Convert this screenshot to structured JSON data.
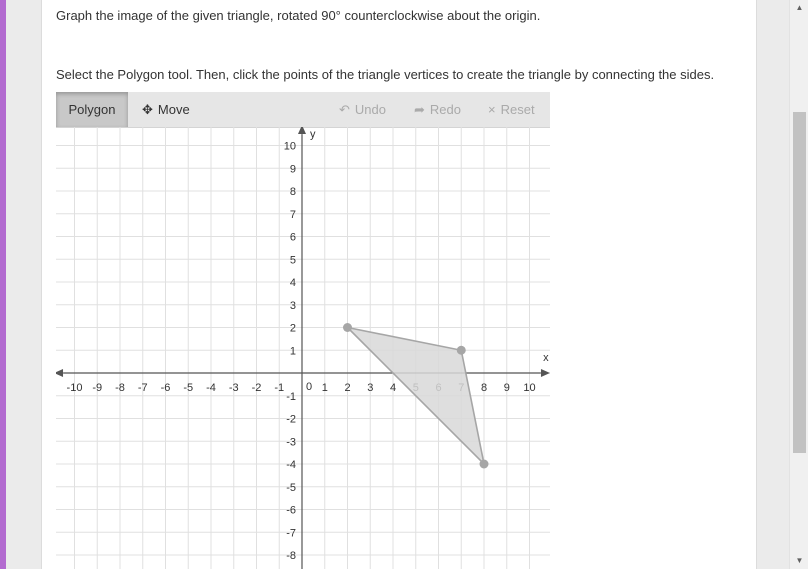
{
  "instructions": {
    "line1": "Graph the image of the given triangle, rotated 90° counterclockwise about the origin.",
    "line2": "Select the Polygon tool. Then, click the points of the triangle vertices to create the triangle by connecting the sides."
  },
  "toolbar": {
    "polygon_label": "Polygon",
    "move_label": "Move",
    "undo_label": "Undo",
    "redo_label": "Redo",
    "reset_label": "Reset",
    "move_icon": "✥",
    "undo_icon": "↶",
    "redo_icon": "➦",
    "reset_icon": "×"
  },
  "graph": {
    "x_axis_label": "x",
    "y_axis_label": "y",
    "x_range": [
      -10,
      10
    ],
    "y_range": [
      -10,
      10
    ],
    "origin_label": "0",
    "triangle_vertices": [
      [
        2,
        2
      ],
      [
        7,
        1
      ],
      [
        8,
        -4
      ]
    ],
    "colors": {
      "grid": "#e0e0e0",
      "axis": "#555555",
      "polygon_fill": "#d8d8d8",
      "polygon_stroke": "#a6a6a6",
      "vertex": "#a6a6a6"
    }
  }
}
